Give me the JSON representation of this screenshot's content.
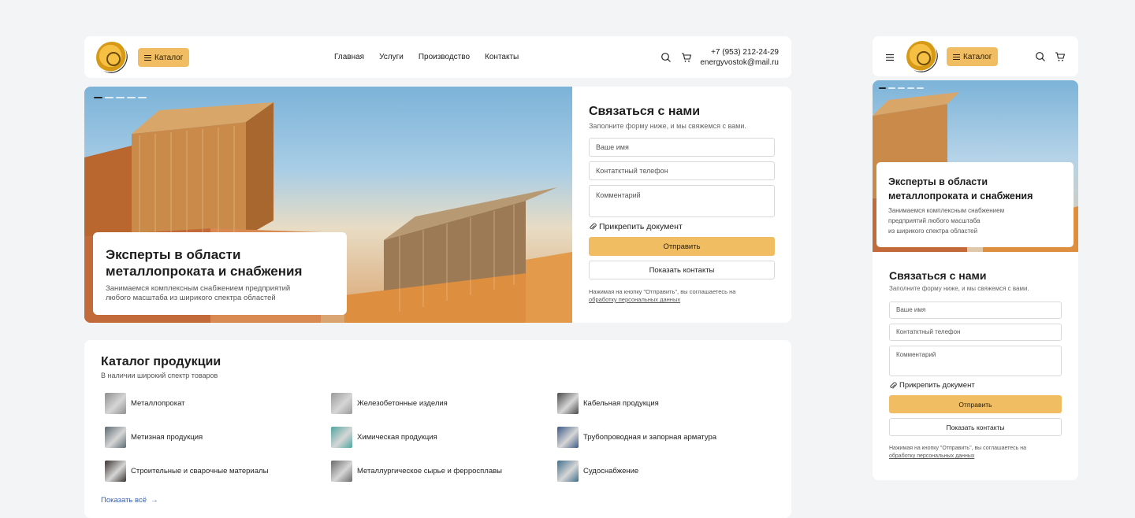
{
  "header": {
    "catalog_button": "Каталог",
    "nav": [
      "Главная",
      "Услуги",
      "Производство",
      "Контакты"
    ],
    "phone": "+7 (953) 212-24-29",
    "email": "energyvostok@mail.ru"
  },
  "hero": {
    "title_line1": "Эксперты в области",
    "title_line2": "металлопроката и снабжения",
    "subtitle_line1": "Занимаемся комплексным снабжением предприятий",
    "subtitle_line2": "любого масштаба из ширикого спектра областей",
    "slides_total": 5,
    "slide_active": 1
  },
  "mobile_hero": {
    "subtitle_line1": "Занимаемся комплексным снабжением",
    "subtitle_line2": "предприятий любого масштаба",
    "subtitle_line3": "из ширикого спектра областей"
  },
  "contact_form": {
    "title": "Связаться с нами",
    "subtitle": "Заполните форму ниже, и мы свяжемся с вами.",
    "name_placeholder": "Ваше имя",
    "phone_placeholder": "Контатктный телефон",
    "comment_placeholder": "Комментарий",
    "attach_label": "Прикрепить документ",
    "submit_label": "Отправить",
    "show_contacts_label": "Показать контакты",
    "consent_text": "Нажимая на кнопку \"Отправить\", вы соглашаетесь на",
    "consent_link": "обработку персональных данных"
  },
  "catalog": {
    "title": "Каталог продукции",
    "subtitle": "В наличии широкий спектр товаров",
    "items": [
      {
        "label": "Металлопрокат",
        "color": "#8e8e8e"
      },
      {
        "label": "Железобетонные изделия",
        "color": "#9a9a9a"
      },
      {
        "label": "Кабельная продукция",
        "color": "#4a4a4a"
      },
      {
        "label": "Метизная продукция",
        "color": "#5c6b72"
      },
      {
        "label": "Химическая продукция",
        "color": "#4fa6a0"
      },
      {
        "label": "Трубопроводная и запорная арматура",
        "color": "#3c5a86"
      },
      {
        "label": "Строительные и сварочные материалы",
        "color": "#3a3330"
      },
      {
        "label": "Металлургическое сырье и ферросплавы",
        "color": "#6a6a6a"
      },
      {
        "label": "Судоснабжение",
        "color": "#3f6f8c"
      }
    ],
    "show_all": "Показать всё"
  },
  "colors": {
    "accent": "#f0bd63",
    "link": "#2f5fb0",
    "background": "#f3f4f6"
  }
}
